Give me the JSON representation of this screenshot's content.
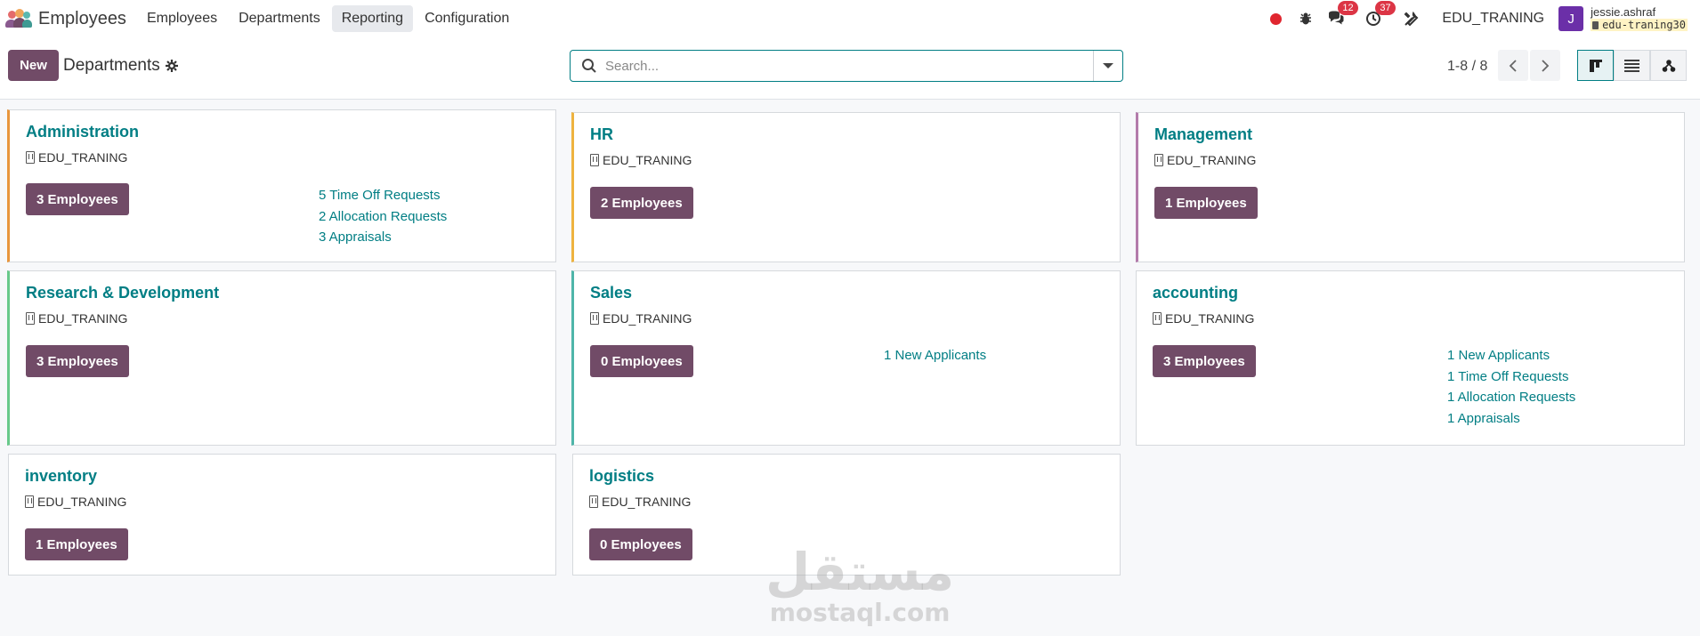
{
  "navbar": {
    "app_title": "Employees",
    "menu": [
      "Employees",
      "Departments",
      "Reporting",
      "Configuration"
    ],
    "active_menu_index": 2,
    "messages_count": "12",
    "activities_count": "37",
    "company": "EDU_TRANING",
    "avatar_initial": "J",
    "user_name": "jessie.ashraf",
    "database": "edu-traning30"
  },
  "control_panel": {
    "new_label": "New",
    "breadcrumb": "Departments",
    "search_placeholder": "Search...",
    "pager": "1-8 / 8",
    "active_view": "kanban"
  },
  "departments": [
    {
      "name": "Administration",
      "company": "EDU_TRANING",
      "employees": "3 Employees",
      "color": "#e8963d",
      "links": [
        "5 Time Off Requests",
        "2 Allocation Requests",
        "3 Appraisals"
      ]
    },
    {
      "name": "HR",
      "company": "EDU_TRANING",
      "employees": "2 Employees",
      "color": "#eeb33f",
      "links": []
    },
    {
      "name": "Management",
      "company": "EDU_TRANING",
      "employees": "1 Employees",
      "color": "#b37bab",
      "links": []
    },
    {
      "name": "Research & Development",
      "company": "EDU_TRANING",
      "employees": "3 Employees",
      "color": "#68c98a",
      "links": []
    },
    {
      "name": "Sales",
      "company": "EDU_TRANING",
      "employees": "0 Employees",
      "color": "#4fb5a9",
      "links": [
        "1 New Applicants"
      ]
    },
    {
      "name": "accounting",
      "company": "EDU_TRANING",
      "employees": "3 Employees",
      "color": "",
      "links": [
        "1 New Applicants",
        "1 Time Off Requests",
        "1 Allocation Requests",
        "1 Appraisals"
      ]
    },
    {
      "name": "inventory",
      "company": "EDU_TRANING",
      "employees": "1 Employees",
      "color": "",
      "links": []
    },
    {
      "name": "logistics",
      "company": "EDU_TRANING",
      "employees": "0 Employees",
      "color": "",
      "links": []
    }
  ],
  "watermark": {
    "arabic": "مستقل",
    "latin": "mostaql.com"
  },
  "icons": {
    "brand": "employees-app-icon",
    "recording": "record-dot-icon",
    "debug": "bug-icon",
    "messages": "chat-icon",
    "activities": "clock-icon",
    "tools": "tools-icon",
    "settings": "gear-icon",
    "search": "search-icon",
    "company": "building-icon"
  },
  "colors": {
    "primary": "#714b67",
    "link": "#017e84",
    "badge": "#dc3545"
  }
}
